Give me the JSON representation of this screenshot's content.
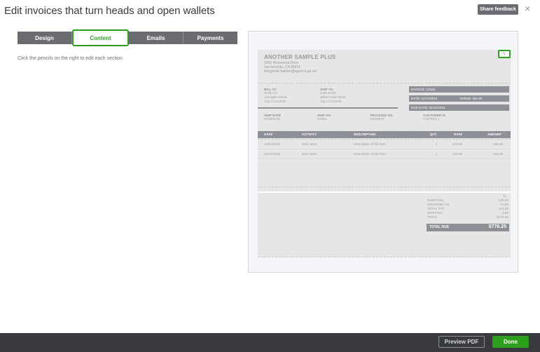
{
  "header": {
    "title": "Edit invoices that turn heads and open wallets",
    "share_feedback": "Share feedback",
    "close": "×"
  },
  "tabs": [
    {
      "label": "Design",
      "active": false
    },
    {
      "label": "Content",
      "active": true
    },
    {
      "label": "Emails",
      "active": false
    },
    {
      "label": "Payments",
      "active": false
    }
  ],
  "hint": "Click the pencils on the right to edit each section.",
  "invoice": {
    "company": "ANOTHER SAMPLE PLUS",
    "address_lines": [
      "3005 Riverwood Drive",
      "Sacramento, CA 95814",
      "fritzgerald.fuddan@agent.b.gs.net"
    ],
    "bill_to": {
      "label": "BILL TO",
      "lines": [
        "Smith Co.",
        "123 Main Street",
        "City, CA 12345"
      ]
    },
    "ship_to": {
      "label": "SHIP TO",
      "lines": [
        "John Smith",
        "20637 Palm Drive",
        "City, CA 12345"
      ]
    },
    "invoice_no": "INVOICE: 12345",
    "date": "DATE:  01/12/2016",
    "terms": "TERMS: Net 30",
    "due_date": "DUE DATE: 02/12/2016",
    "ship_date": {
      "label": "SHIP DATE",
      "value": "01/03/2016"
    },
    "ship_via": {
      "label": "SHIP VIA",
      "value": "FedEx"
    },
    "tracking": {
      "label": "TRACKING NO.",
      "value": "12345678"
    },
    "customer_id": {
      "label": "CUSTOMER ID",
      "value": "CUSTOM 1"
    },
    "columns": [
      "DATE",
      "ACTIVITY",
      "DESCRIPTION",
      "QTY",
      "RATE",
      "AMOUNT"
    ],
    "rows": [
      [
        "12/01/2016",
        "Item name",
        "Description of the item",
        "2",
        "225.00",
        "450.00"
      ],
      [
        "01/12/2016",
        "Item name",
        "Description of the item",
        "1",
        "225.00",
        "225.00"
      ]
    ],
    "totals": [
      {
        "label": "SUBTOTAL",
        "value": "675.00"
      },
      {
        "label": "DISCOUNT 2%",
        "value": "-13.50"
      },
      {
        "label": "TOTAL TAX",
        "value": "101.25"
      },
      {
        "label": "SHIPPING",
        "value": "3.50"
      },
      {
        "label": "TOTAL",
        "value": "$776.25"
      }
    ],
    "total_due_label": "TOTAL DUE",
    "total_due_value": "$776.25"
  },
  "footer": {
    "preview_pdf": "Preview PDF",
    "done": "Done"
  },
  "colors": {
    "accent_green": "#2ca01c",
    "tab_gray": "#6b6c72",
    "footer_dark": "#393a3d"
  }
}
